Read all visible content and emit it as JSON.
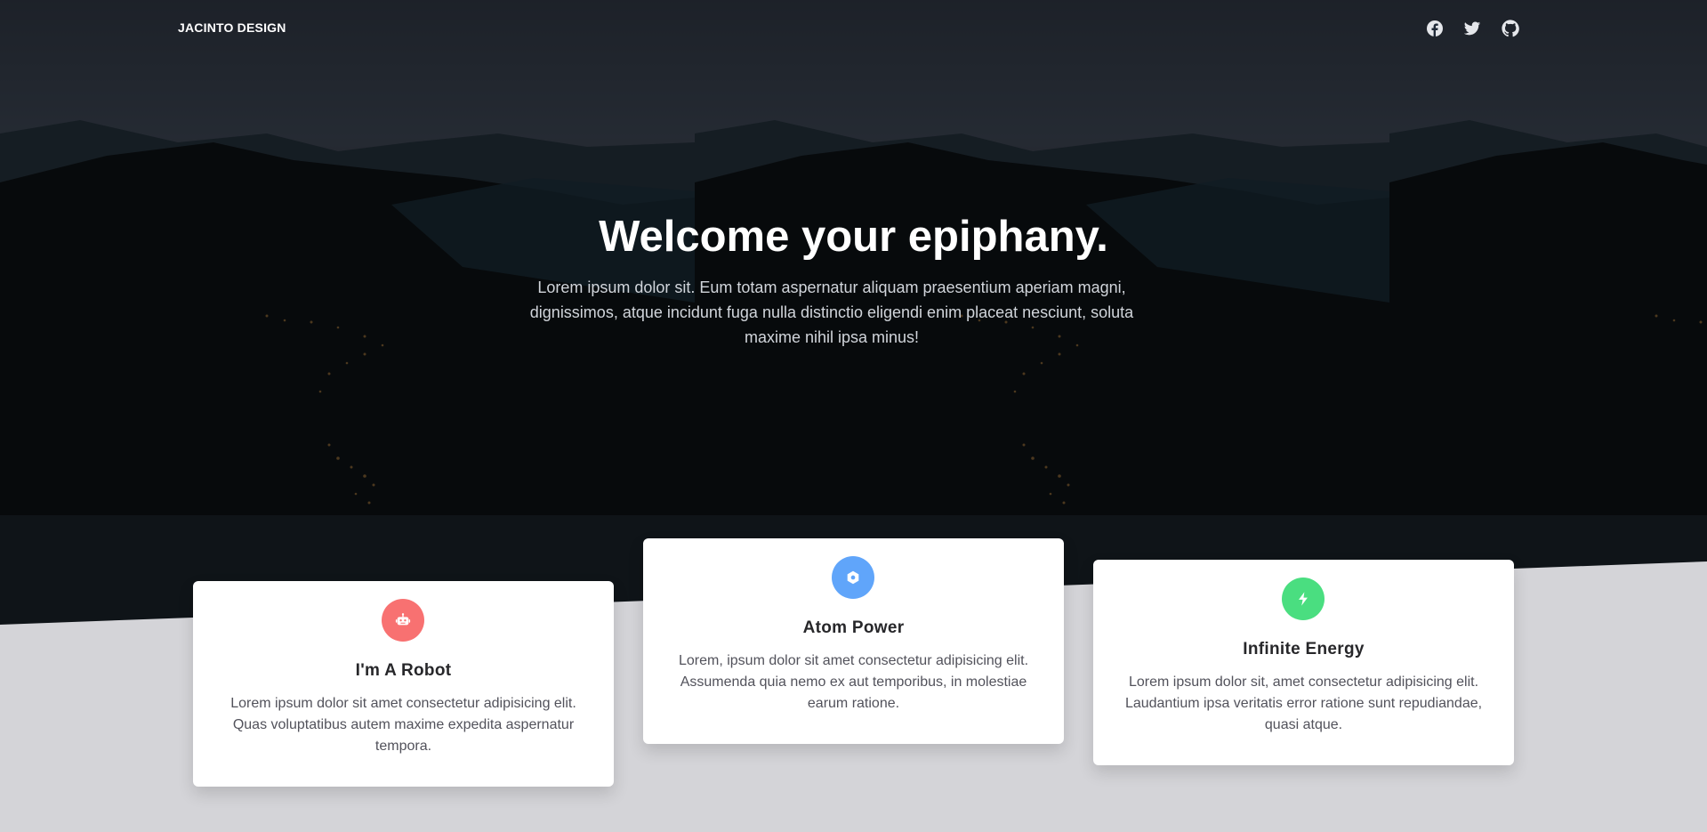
{
  "nav": {
    "brand": "JACINTO DESIGN",
    "social": [
      {
        "icon": "facebook-icon"
      },
      {
        "icon": "twitter-icon"
      },
      {
        "icon": "github-icon"
      }
    ]
  },
  "hero": {
    "title": "Welcome your epiphany.",
    "text": "Lorem ipsum dolor sit. Eum totam aspernatur aliquam praesentium aperiam magni, dignissimos, atque incidunt fuga nulla distinctio eligendi enim placeat nesciunt, soluta maxime nihil ipsa minus!"
  },
  "cards": [
    {
      "icon": "robot-icon",
      "icon_color": "#f87171",
      "title": "I'm A Robot",
      "text": "Lorem ipsum dolor sit amet consectetur adipisicing elit. Quas voluptatibus autem maxime expedita aspernatur tempora."
    },
    {
      "icon": "atom-icon",
      "icon_color": "#60a5fa",
      "title": "Atom Power",
      "text": "Lorem, ipsum dolor sit amet consectetur adipisicing elit. Assumenda quia nemo ex aut temporibus, in molestiae earum ratione."
    },
    {
      "icon": "bolt-icon",
      "icon_color": "#4ade80",
      "title": "Infinite Energy",
      "text": "Lorem ipsum dolor sit, amet consectetur adipisicing elit. Laudantium ipsa veritatis error ratione sunt repudiandae, quasi atque."
    }
  ],
  "colors": {
    "page_bg": "#d4d4d8",
    "card_bg": "#ffffff",
    "title_text": "#27272a"
  }
}
